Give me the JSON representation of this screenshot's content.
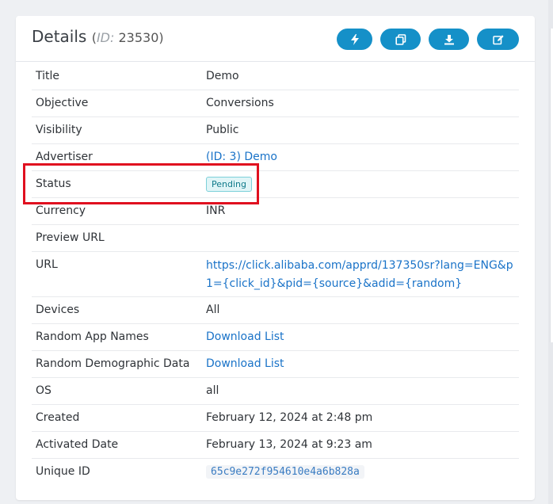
{
  "details": {
    "title": "Details",
    "id_open": "(",
    "id_label": "ID:",
    "id_value": "23530",
    "id_close": ")"
  },
  "actions": [
    {
      "icon": "bolt-icon"
    },
    {
      "icon": "copy-icon"
    },
    {
      "icon": "download-icon"
    },
    {
      "icon": "edit-icon"
    }
  ],
  "colors": {
    "accent": "#1590c8",
    "link": "#1a73c8",
    "highlight": "#e0101f"
  },
  "rows": {
    "title": {
      "label": "Title",
      "value": "Demo"
    },
    "objective": {
      "label": "Objective",
      "value": "Conversions"
    },
    "visibility": {
      "label": "Visibility",
      "value": "Public"
    },
    "advertiser": {
      "label": "Advertiser",
      "value": "(ID: 3) Demo"
    },
    "status": {
      "label": "Status",
      "value": "Pending"
    },
    "currency": {
      "label": "Currency",
      "value": "INR"
    },
    "preview_url": {
      "label": "Preview URL",
      "value": ""
    },
    "url": {
      "label": "URL",
      "value": "https://click.alibaba.com/apprd/137350sr?lang=ENG&p1={click_id}&pid={source}&adid={random}"
    },
    "devices": {
      "label": "Devices",
      "value": "All"
    },
    "random_app_names": {
      "label": "Random App Names",
      "value": "Download List"
    },
    "random_demo": {
      "label": "Random Demographic Data",
      "value": "Download List"
    },
    "os": {
      "label": "OS",
      "value": "all"
    },
    "created": {
      "label": "Created",
      "value": "February 12, 2024 at 2:48 pm"
    },
    "activated": {
      "label": "Activated Date",
      "value": "February 13, 2024 at 9:23 am"
    },
    "unique_id": {
      "label": "Unique ID",
      "value": "65c9e272f954610e4a6b828a"
    }
  }
}
